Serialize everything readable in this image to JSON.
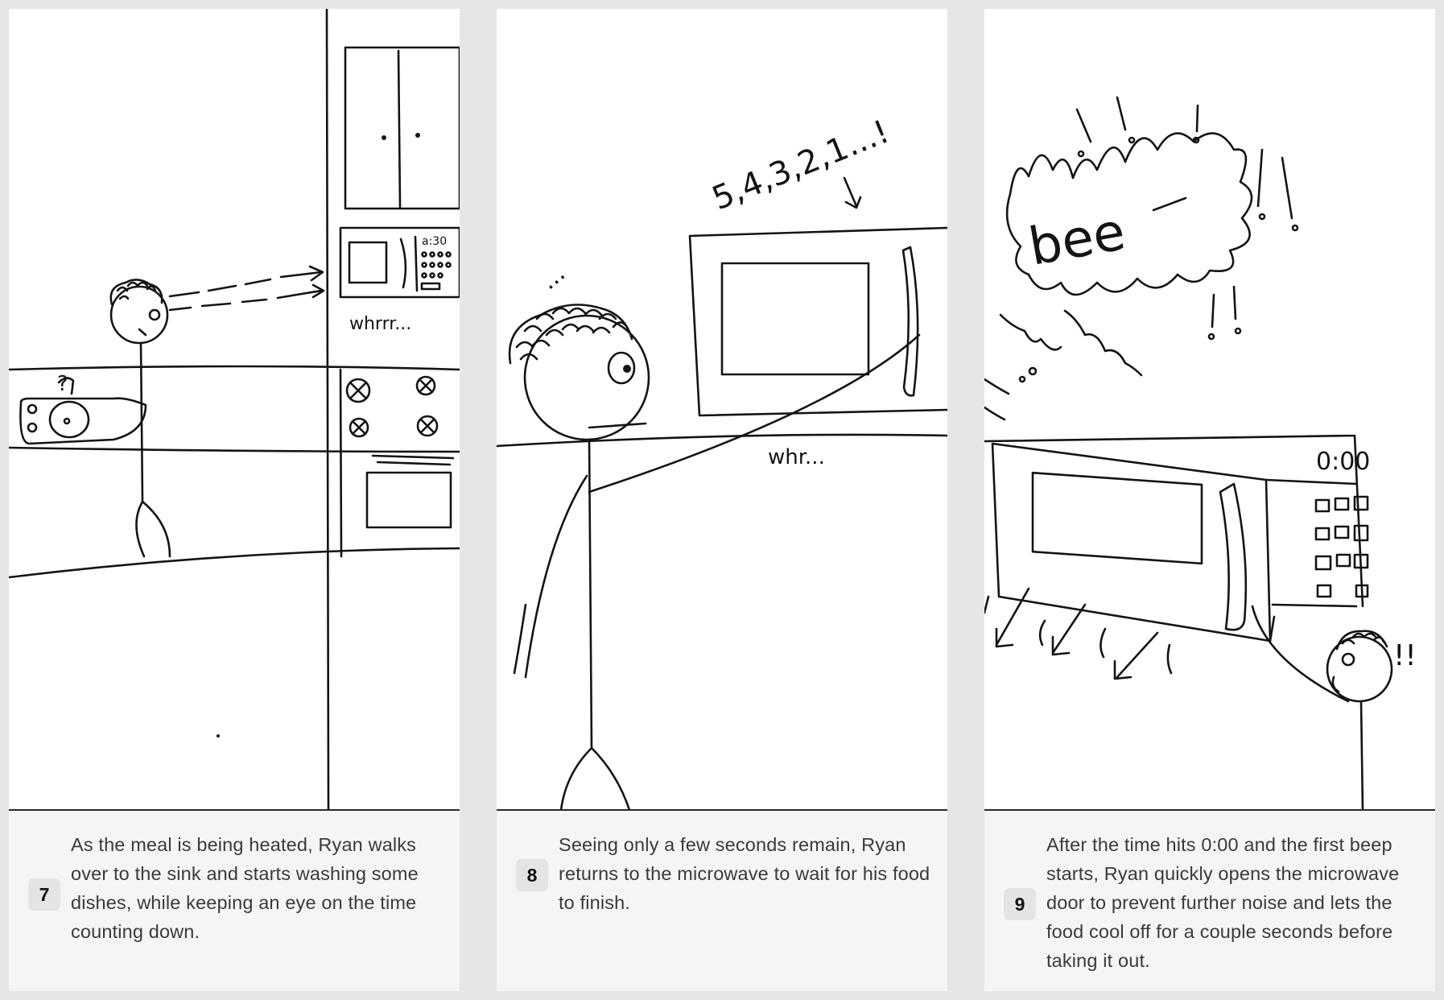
{
  "panels": [
    {
      "number": "7",
      "caption": "As the meal is being heated, Ryan walks over to the sink and starts washing some dishes, while keeping an eye on the time counting down.",
      "sketch_text": {
        "microwave_display": "a:30",
        "sound": "whrrr...",
        "note": "?"
      }
    },
    {
      "number": "8",
      "caption": "Seeing only a few seconds remain, Ryan returns to the microwave to wait for his food to finish.",
      "sketch_text": {
        "countdown": "5,4,3,2,1...!",
        "sound": "whr...",
        "thought": "..."
      }
    },
    {
      "number": "9",
      "caption": "After the time hits 0:00 and the first beep starts, Ryan quickly opens the microwave door to prevent further noise and lets the food cool off for a couple seconds before taking it out.",
      "sketch_text": {
        "beep": "bee",
        "microwave_display": "0:00",
        "exclaim": "!!"
      }
    }
  ]
}
